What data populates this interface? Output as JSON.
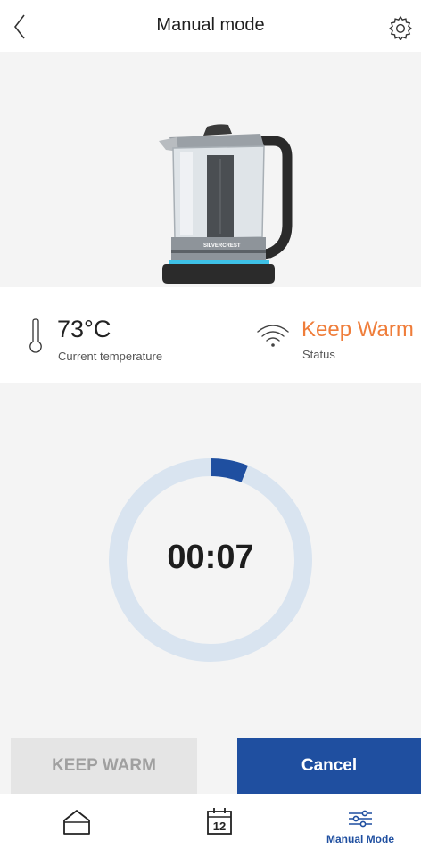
{
  "header": {
    "title": "Manual mode",
    "back_icon": "chevron-left-icon",
    "settings_icon": "gear-icon"
  },
  "device": {
    "brand": "SILVERCREST",
    "image": "kettle-illustration"
  },
  "info": {
    "temperature_value": "73°C",
    "temperature_label": "Current temperature",
    "status_value": "Keep Warm",
    "status_label": "Status"
  },
  "timer": {
    "display": "00:07",
    "progress": 0.06
  },
  "buttons": {
    "keep_warm_label": "KEEP WARM",
    "cancel_label": "Cancel"
  },
  "bottom_nav": {
    "home_icon": "home-icon",
    "calendar_day": "12",
    "manual_label": "Manual Mode",
    "manual_icon": "sliders-icon"
  },
  "colors": {
    "accent": "#1f4fa0",
    "status_orange": "#ef7d3a",
    "ring_track": "#d9e4f0",
    "background_gray": "#f4f4f4"
  }
}
